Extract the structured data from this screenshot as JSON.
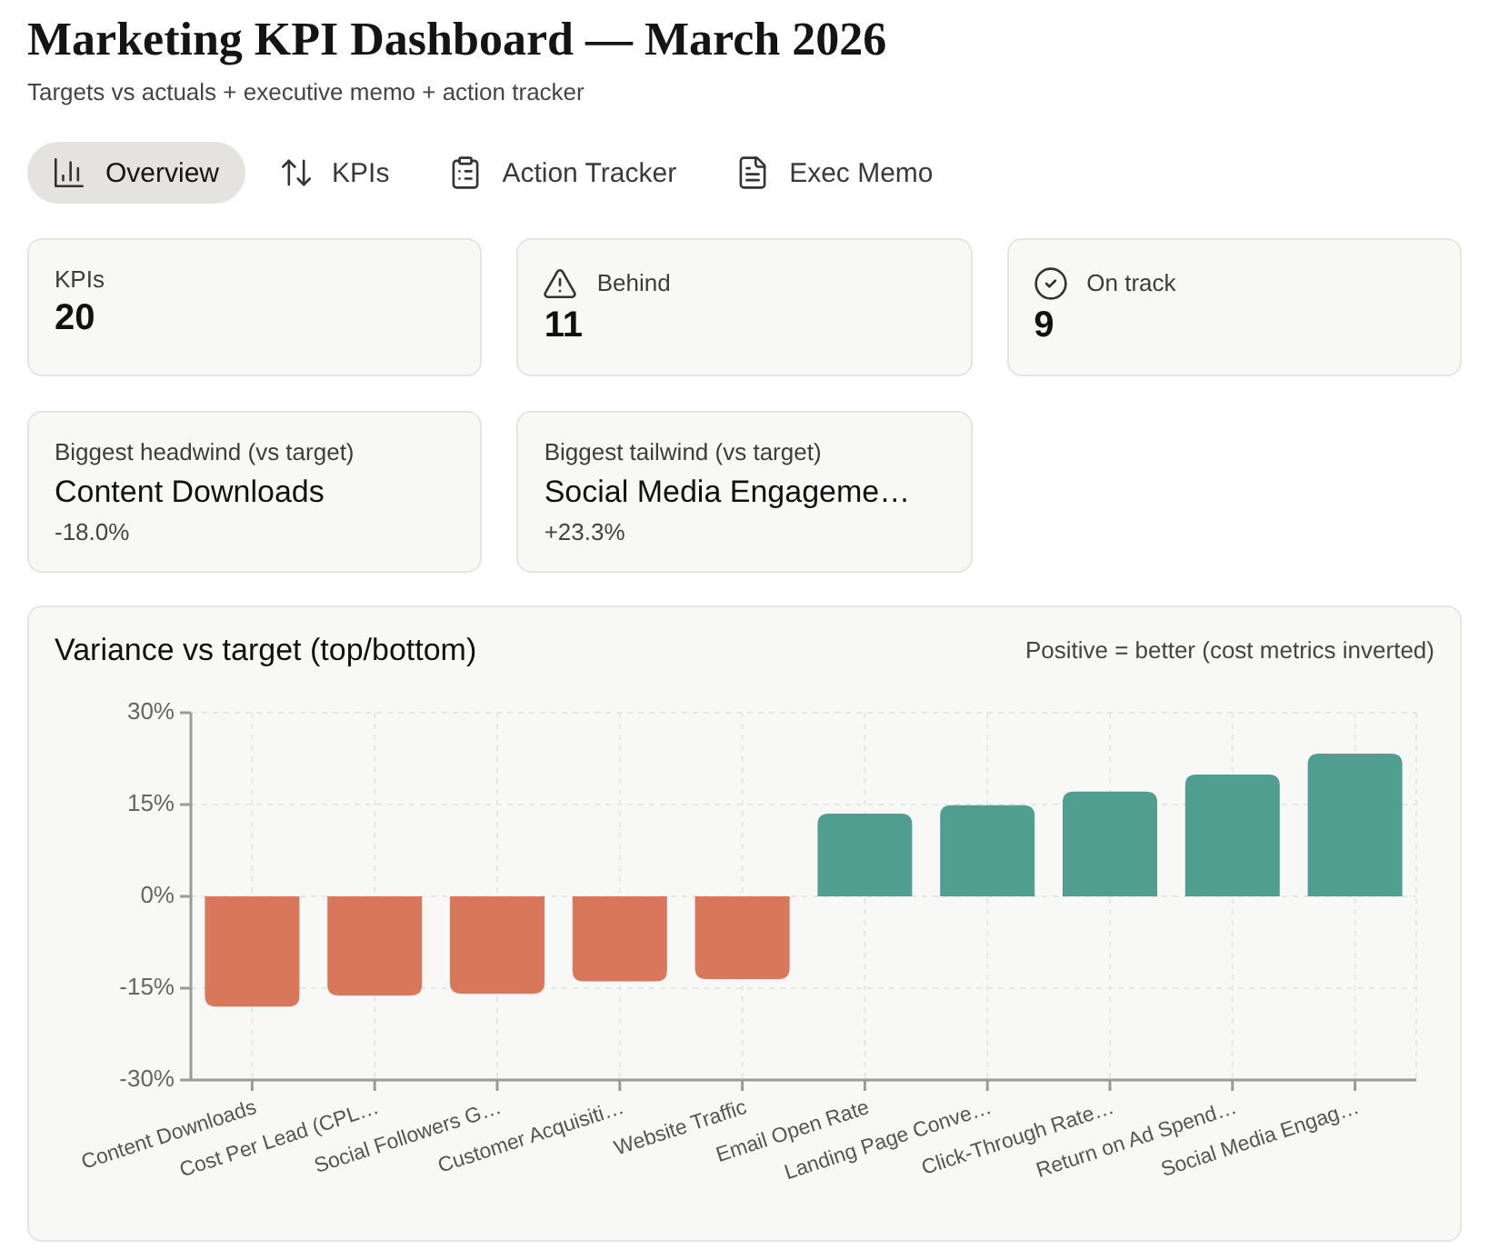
{
  "header": {
    "title": "Marketing KPI Dashboard — March 2026",
    "subtitle": "Targets vs actuals + executive memo + action tracker"
  },
  "tabs": [
    {
      "label": "Overview",
      "selected": true
    },
    {
      "label": "KPIs",
      "selected": false
    },
    {
      "label": "Action Tracker",
      "selected": false
    },
    {
      "label": "Exec Memo",
      "selected": false
    }
  ],
  "stats": [
    {
      "kind": "count",
      "label": "KPIs",
      "value": "20"
    },
    {
      "kind": "warning",
      "label": "Behind",
      "value": "11"
    },
    {
      "kind": "success",
      "label": "On track",
      "value": "9"
    }
  ],
  "highlights": [
    {
      "label": "Biggest headwind (vs target)",
      "value": "Content Downloads",
      "change": "-18.0%"
    },
    {
      "label": "Biggest tailwind (vs target)",
      "value": "Social Media Engageme…",
      "change": "+23.3%"
    }
  ],
  "chart_panel": {
    "note": "Positive = better (cost metrics inverted)",
    "chart_data": {
      "type": "bar",
      "title": "Variance vs target (top/bottom)",
      "categories": [
        "Content Downloads",
        "Cost Per Lead (CPL…",
        "Social Followers G…",
        "Customer Acquisiti…",
        "Website Traffic",
        "Email Open Rate",
        "Landing Page Conve…",
        "Click-Through Rate…",
        "Return on Ad Spend…",
        "Social Media Engag…"
      ],
      "series": [
        {
          "color": "#d9775a",
          "values": [
            -18.0,
            -16.2,
            -15.9,
            -13.9,
            -13.5,
            null,
            null,
            null,
            null,
            null
          ]
        },
        {
          "color": "#509e90",
          "values": [
            null,
            null,
            null,
            null,
            null,
            13.5,
            14.9,
            17.1,
            19.9,
            23.3
          ]
        }
      ],
      "stacked": true,
      "grid": true,
      "ylim": [
        -30,
        30
      ],
      "yticks": [
        {
          "value": -30,
          "label": "-30%"
        },
        {
          "value": -15,
          "label": "-15%"
        },
        {
          "value": 0,
          "label": "0%"
        },
        {
          "value": 15,
          "label": "15%"
        },
        {
          "value": 30,
          "label": "30%"
        }
      ]
    }
  }
}
